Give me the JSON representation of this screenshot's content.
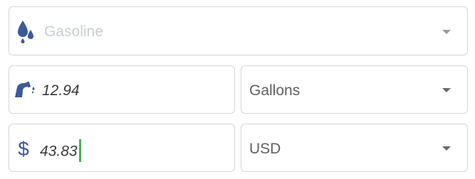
{
  "fuel_type": {
    "placeholder": "Gasoline",
    "icon": "fuel-drops-icon"
  },
  "amount": {
    "value": "12.94",
    "icon": "fuel-nozzle-icon"
  },
  "unit": {
    "selected": "Gallons"
  },
  "price": {
    "value": "43.83",
    "icon": "dollar-icon"
  },
  "currency": {
    "selected": "USD"
  },
  "colors": {
    "icon": "#3b5a9a",
    "cursor": "#4caf50",
    "border": "#d6d6d6"
  }
}
